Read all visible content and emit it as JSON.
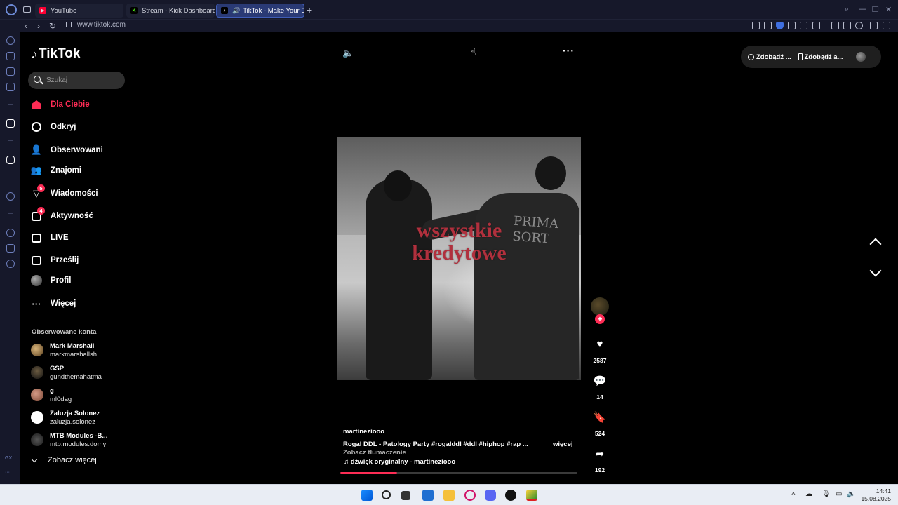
{
  "browser": {
    "tabs": [
      {
        "label": "YouTube",
        "icon": "youtube-icon"
      },
      {
        "label": "Stream - Kick Dashboard",
        "icon": "kick-icon"
      },
      {
        "label": "TikTok - Make Your Day",
        "icon": "tiktok-icon"
      }
    ],
    "url": "www.tiktok.com"
  },
  "tiktok": {
    "logo": "TikTok",
    "search": {
      "placeholder": "Szukaj",
      "value": ""
    },
    "nav": [
      {
        "label": "Dla Ciebie",
        "icon": "home-icon",
        "active": true
      },
      {
        "label": "Odkryj",
        "icon": "compass-icon"
      },
      {
        "label": "Obserwowani",
        "icon": "user-follow-icon"
      },
      {
        "label": "Znajomi",
        "icon": "friends-icon"
      },
      {
        "label": "Wiadomości",
        "icon": "messages-icon",
        "badge": "5"
      },
      {
        "label": "Aktywność",
        "icon": "activity-icon",
        "badge": "4"
      },
      {
        "label": "LIVE",
        "icon": "live-icon"
      },
      {
        "label": "Prześlij",
        "icon": "upload-icon"
      },
      {
        "label": "Profil",
        "icon": "profile-avatar"
      },
      {
        "label": "Więcej",
        "icon": "more-icon"
      }
    ],
    "followed_title": "Obserwowane konta",
    "followed": [
      {
        "name": "Mark Marshall",
        "username": "markmarshallsh"
      },
      {
        "name": "GSP",
        "username": "gundthemahatma"
      },
      {
        "name": "g",
        "username": "ml0dag"
      },
      {
        "name": "Żaluzja Solonez",
        "username": "zaluzja.solonez"
      },
      {
        "name": "MTB Modules -B...",
        "username": "mtb.modules.domy"
      }
    ],
    "see_more": "Zobacz więcej",
    "header_buttons": [
      "Zdobądź ...",
      "Zdobądź a..."
    ],
    "video": {
      "overlay_line1": "wszystkie",
      "overlay_line2": "kredytowe",
      "shirt_text": "PRIMA SORT"
    },
    "actions": {
      "likes": "2587",
      "comments": "14",
      "saves": "524",
      "shares": "192"
    },
    "caption": {
      "username": "martineziooo",
      "description": "Rogal DDL - Patology Party #rogalddl  #ddl  #hiphop  #rap  ...",
      "more": "więcej",
      "translate": "Zobacz tłumaczenie",
      "music": "dźwięk oryginalny - martineziooo"
    },
    "progress": 0.24,
    "accent": "#fe2c55"
  },
  "taskbar": {
    "time": "14:41",
    "date": "15.08.2025"
  }
}
